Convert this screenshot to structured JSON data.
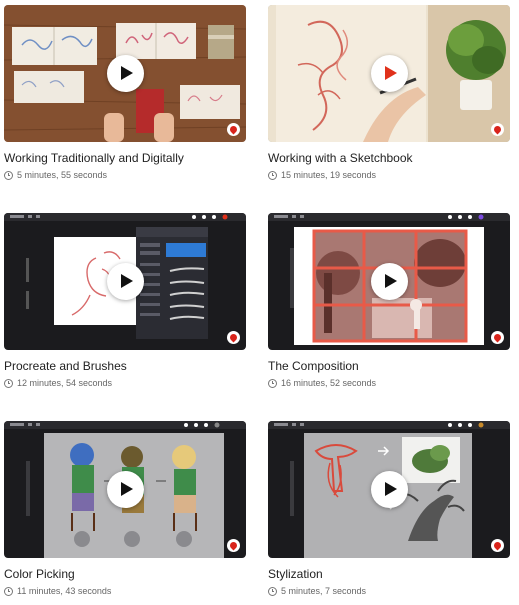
{
  "colors": {
    "accent": "#e0311b",
    "text": "#222222",
    "meta": "#666666"
  },
  "icons": {
    "play": "play-icon",
    "clock": "clock-icon",
    "brand": "brand-badge-icon"
  },
  "lessons": [
    {
      "title": "Working Traditionally and Digitally",
      "duration": "5 minutes, 55 seconds",
      "thumbnail": "sketchbooks-on-table"
    },
    {
      "title": "Working with a Sketchbook",
      "duration": "15 minutes, 19 seconds",
      "thumbnail": "hand-drawing-in-sketchbook"
    },
    {
      "title": "Procreate and Brushes",
      "duration": "12 minutes, 54 seconds",
      "thumbnail": "procreate-brush-library"
    },
    {
      "title": "The Composition",
      "duration": "16 minutes, 52 seconds",
      "thumbnail": "composition-grid-illustration"
    },
    {
      "title": "Color Picking",
      "duration": "11 minutes, 43 seconds",
      "thumbnail": "character-color-studies"
    },
    {
      "title": "Stylization",
      "duration": "5 minutes, 7 seconds",
      "thumbnail": "stylized-trees-sketch"
    }
  ]
}
